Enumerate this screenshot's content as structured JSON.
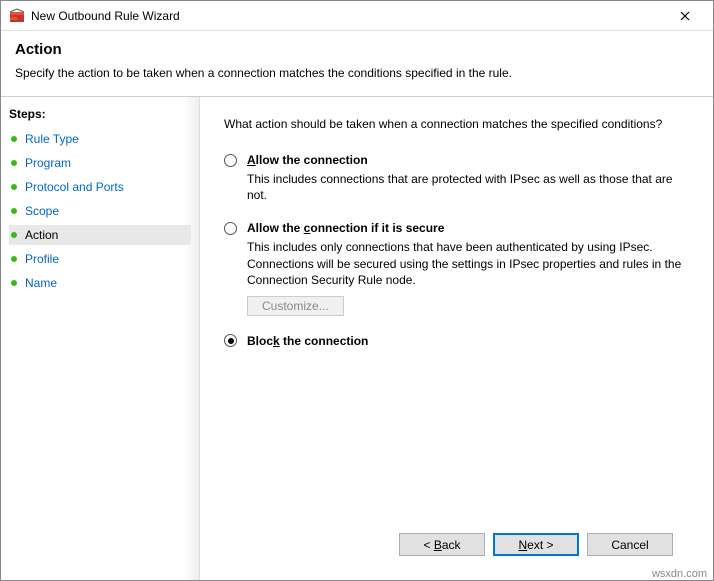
{
  "titlebar": {
    "title": "New Outbound Rule Wizard"
  },
  "header": {
    "title": "Action",
    "desc": "Specify the action to be taken when a connection matches the conditions specified in the rule."
  },
  "sidebar": {
    "title": "Steps:",
    "items": [
      {
        "label": "Rule Type",
        "current": false
      },
      {
        "label": "Program",
        "current": false
      },
      {
        "label": "Protocol and Ports",
        "current": false
      },
      {
        "label": "Scope",
        "current": false
      },
      {
        "label": "Action",
        "current": true
      },
      {
        "label": "Profile",
        "current": false
      },
      {
        "label": "Name",
        "current": false
      }
    ]
  },
  "main": {
    "question": "What action should be taken when a connection matches the specified conditions?",
    "options": {
      "allow": {
        "label": "Allow the connection",
        "desc": "This includes connections that are protected with IPsec as well as those that are not."
      },
      "allow_secure": {
        "label": "Allow the connection if it is secure",
        "desc": "This includes only connections that have been authenticated by using IPsec.  Connections will be secured using the settings in IPsec properties and rules in the Connection Security Rule node.",
        "customize": "Customize..."
      },
      "block": {
        "label": "Block the connection"
      }
    }
  },
  "footer": {
    "back": "< Back",
    "next": "Next >",
    "cancel": "Cancel"
  },
  "watermark": "wsxdn.com"
}
